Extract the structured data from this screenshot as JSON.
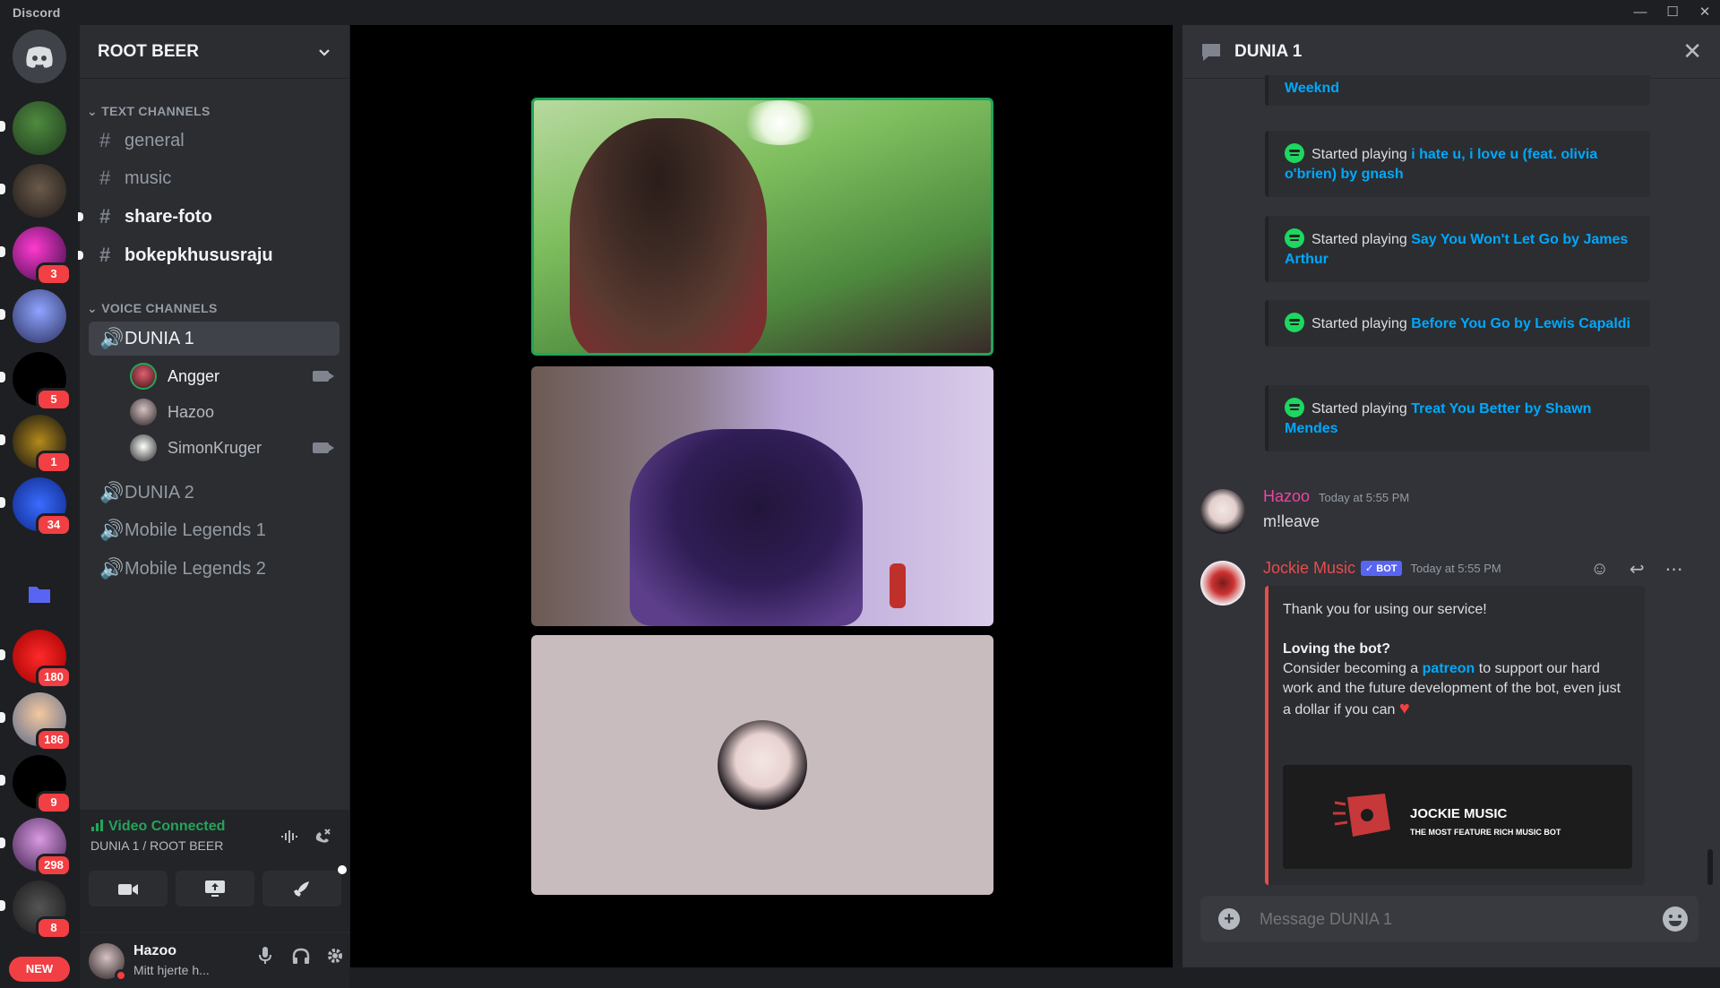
{
  "window": {
    "brand": "Discord",
    "minimize_glyph": "—",
    "maximize_glyph": "☐",
    "close_glyph": "✕"
  },
  "servers": {
    "badges": [
      "3",
      "5",
      "1",
      "34",
      "180",
      "186",
      "9",
      "298",
      "8"
    ],
    "new_label": "NEW"
  },
  "guild": {
    "name": "ROOT BEER",
    "text_category": "TEXT CHANNELS",
    "voice_category": "VOICE CHANNELS",
    "text_channels": [
      "general",
      "music",
      "share-foto",
      "bokepkhususraju"
    ],
    "voice_channels": [
      "DUNIA 1",
      "DUNIA 2",
      "Mobile Legends 1",
      "Mobile Legends 2"
    ],
    "voice_members": [
      "Angger",
      "Hazoo",
      "SimonKruger"
    ]
  },
  "voice": {
    "status": "Video Connected",
    "location": "DUNIA 1 / ROOT BEER"
  },
  "user": {
    "name": "Hazoo",
    "status": "Mitt hjerte h..."
  },
  "chat": {
    "title": "DUNIA 1",
    "started": "Started playing",
    "songs": {
      "s1": "i hate u, i love u (feat. olivia o'brien) by gnash",
      "s2": "Say You Won't Let Go by James Arthur",
      "s3": "Before You Go by Lewis Capaldi",
      "s4": "Treat You Better by Shawn Mendes",
      "partial_visible": "Weeknd"
    },
    "msg1": {
      "author": "Hazoo",
      "time": "Today at 5:55 PM",
      "text": "m!leave"
    },
    "msg2": {
      "author": "Jockie Music",
      "bot_tag": "✓ BOT",
      "time": "Today at 5:55 PM",
      "line1": "Thank you for using our service!",
      "heading": "Loving the bot?",
      "body_pre": "Consider becoming a ",
      "link": "patreon",
      "body_post": " to support our hard work and the future development of the bot, even just a dollar if you can ",
      "heart": "♥",
      "banner_title": "JOCKIE MUSIC",
      "banner_sub": "THE MOST FEATURE RICH MUSIC BOT"
    },
    "input_placeholder": "Message DUNIA 1"
  },
  "colors": {
    "spotify_green": "#1ed760",
    "link_blue": "#00a8fc",
    "danger_red": "#f23f43",
    "connected_green": "#23a55a",
    "hazoo_pink": "#eb459e",
    "jockie_red": "#e84c4c",
    "bot_blurple": "#5865f2"
  }
}
